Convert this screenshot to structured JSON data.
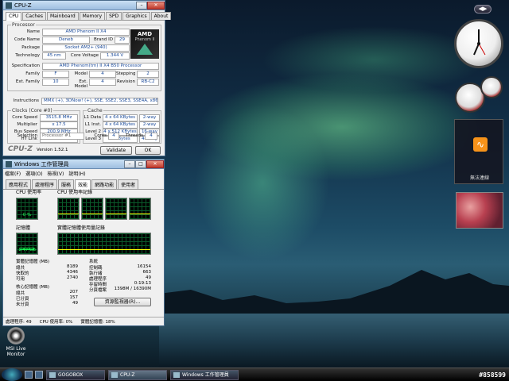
{
  "cpuz": {
    "title": "CPU-Z",
    "tabs": [
      "CPU",
      "Caches",
      "Mainboard",
      "Memory",
      "SPD",
      "Graphics",
      "About"
    ],
    "processor_group": "Processor",
    "name_label": "Name",
    "name": "AMD Phenom II X4",
    "codename_label": "Code Name",
    "codename": "Deneb",
    "brandid_label": "Brand ID",
    "brandid": "29",
    "package_label": "Package",
    "package": "Socket AM2+ (940)",
    "technology_label": "Technology",
    "technology": "45 nm",
    "corevoltage_label": "Core Voltage",
    "corevoltage": "1.344 V",
    "spec_label": "Specification",
    "spec": "AMD Phenom(tm) II X4 B50 Processor",
    "family_label": "Family",
    "family": "F",
    "model_label": "Model",
    "model": "4",
    "stepping_label": "Stepping",
    "stepping": "2",
    "extfamily_label": "Ext. Family",
    "extfamily": "10",
    "extmodel_label": "Ext. Model",
    "extmodel": "4",
    "revision_label": "Revision",
    "revision": "RB-C2",
    "instructions_label": "Instructions",
    "instructions": "MMX (+), 3DNow! (+), SSE, SSE2, SSE3, SSE4A, x86-64",
    "logo_text": "AMD",
    "logo_sub": "Phenom II",
    "clocks_group": "Clocks (Core #0)",
    "corespeed_label": "Core Speed",
    "corespeed": "3515.8 MHz",
    "multiplier_label": "Multiplier",
    "multiplier": "x 17.5",
    "busspeed_label": "Bus Speed",
    "busspeed": "200.9 MHz",
    "htlink_label": "HT Link",
    "htlink": "2009.0 MHz",
    "cache_group": "Cache",
    "l1d_label": "L1 Data",
    "l1d": "4 x 64 KBytes",
    "l1d_way": "2-way",
    "l1i_label": "L1 Inst.",
    "l1i": "4 x 64 KBytes",
    "l1i_way": "2-way",
    "l2_label": "Level 2",
    "l2": "4 x 512 KBytes",
    "l2_way": "16-way",
    "l3_label": "Level 3",
    "l3": "6 MBytes",
    "l3_way": "48-way",
    "selection_label": "Selection",
    "selection": "Processor #1",
    "cores_label": "Cores",
    "cores": "4",
    "threads_label": "Threads",
    "threads": "4",
    "brand": "CPU-Z",
    "version": "Version 1.52.1",
    "validate": "Validate",
    "ok": "OK"
  },
  "taskmgr": {
    "title": "Windows 工作管理員",
    "menu": [
      "檔案(F)",
      "選項(O)",
      "檢視(V)",
      "說明(H)"
    ],
    "tabs": [
      "應用程式",
      "處理程序",
      "服務",
      "效能",
      "網路功能",
      "使用者"
    ],
    "cpu_usage_label": "CPU 使用率",
    "cpu_usage_value": "0 %",
    "cpu_history_label": "CPU 使用率記錄",
    "memory_label": "記憶體",
    "memory_value": "1.47 GB",
    "memory_history_label": "實體記憶體使用量記錄",
    "memory_fill_fraction": 0.18,
    "phys_group": "實體記憶體 (MB)",
    "phys_total_label": "總共",
    "phys_total": "8189",
    "phys_cached_label": "快取的",
    "phys_cached": "4346",
    "phys_avail_label": "可用",
    "phys_avail": "2740",
    "kernel_group": "核心記憶體 (MB)",
    "kernel_total_label": "總共",
    "kernel_total": "207",
    "kernel_paged_label": "已分頁",
    "kernel_paged": "157",
    "kernel_nonpaged_label": "未分頁",
    "kernel_nonpaged": "49",
    "system_group": "系統",
    "handles_label": "控制碼",
    "handles": "16154",
    "threads_label": "執行緒",
    "threads": "663",
    "processes_label": "處理程序",
    "processes": "49",
    "uptime_label": "存留時間",
    "uptime": "0:19:13",
    "pagefile_label": "分頁檔案",
    "pagefile": "1398M / 16390M",
    "resource_button": "資源監視器(R)...",
    "status_processes": "處理程序: 49",
    "status_cpu": "CPU 使用率: 0%",
    "status_memory": "實體記憶體: 18%"
  },
  "desktop": {
    "gadget_rss_label": "無法連線",
    "icon_label_1": "MSI Live",
    "icon_label_2": "Monitor"
  },
  "taskbar": {
    "items": [
      "GOGOBOX",
      "CPU-Z",
      "Windows 工作管理員"
    ],
    "tray_text": "#858599"
  }
}
